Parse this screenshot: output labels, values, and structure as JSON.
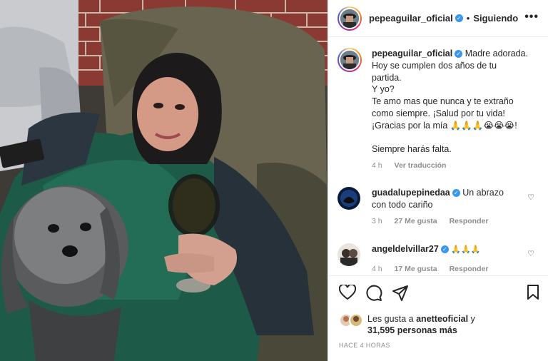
{
  "post": {
    "username": "pepeaguilar_oficial",
    "verified_icon": "verified-badge-icon",
    "dot": "•",
    "follow_status": "Siguiendo",
    "more_label": "•••"
  },
  "caption": {
    "username": "pepeaguilar_oficial",
    "lines": [
      "Madre adorada.",
      "Hoy se cumplen dos años de tu",
      "partida.",
      "Y yo?",
      "Te amo mas que nunca y te extraño",
      "como siempre. ¡Salud por tu vida!",
      "¡Gracias por la mía 🙏🙏🙏😭😭😭!",
      "",
      "Siempre harás falta."
    ],
    "time": "4 h",
    "translate": "Ver traducción"
  },
  "comments": [
    {
      "username": "guadalupepinedaa",
      "verified": true,
      "text_lines": [
        "Un abrazo",
        "con todo cariño"
      ],
      "time": "3 h",
      "likes": "27 Me gusta",
      "reply": "Responder"
    },
    {
      "username": "angeldelvillar27",
      "verified": true,
      "text_lines": [
        "🙏🙏🙏"
      ],
      "time": "4 h",
      "likes": "17 Me gusta",
      "reply": "Responder"
    }
  ],
  "likes": {
    "line1_prefix": "Les gusta a ",
    "line1_user": "anetteoficial",
    "line1_suffix": " y",
    "line2": "31,595 personas más"
  },
  "timestamp": "HACE 4 HORAS",
  "colors": {
    "verified": "#3897f0",
    "muted": "#8e8e8e",
    "text": "#262626"
  }
}
